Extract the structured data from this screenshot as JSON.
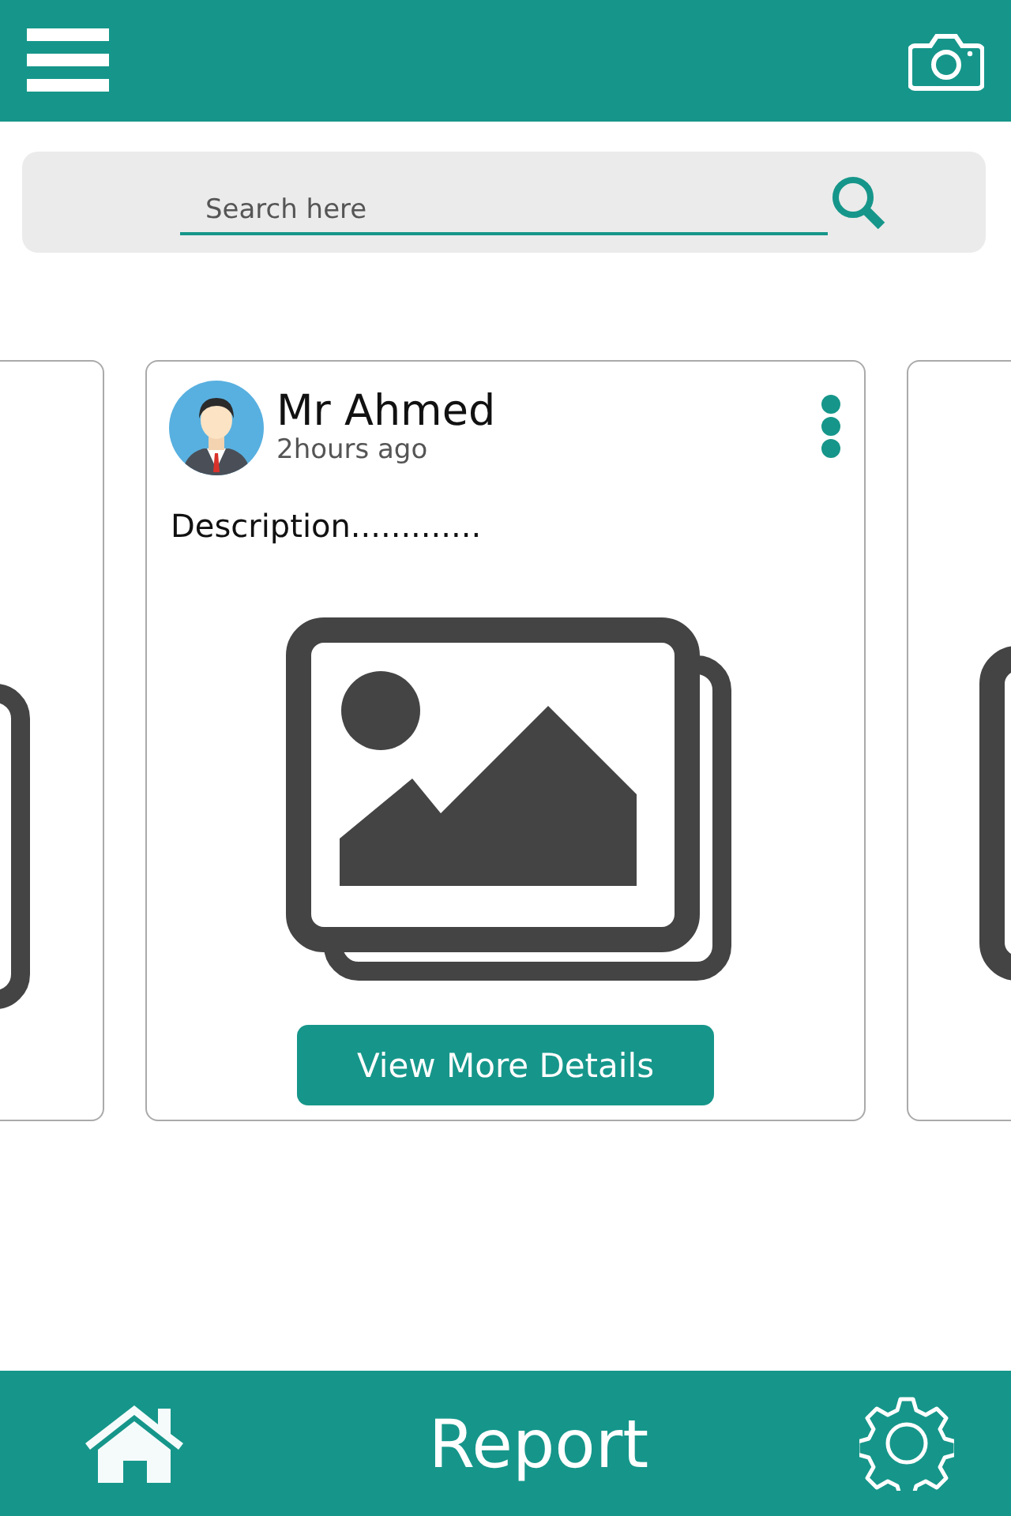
{
  "search": {
    "placeholder": "Search here"
  },
  "cards": [
    {
      "kind": "partial"
    },
    {
      "kind": "post",
      "author": "Mr Ahmed",
      "time": "2hours ago",
      "description": "Description.............",
      "button": "View More Details"
    },
    {
      "kind": "partial"
    }
  ],
  "footer": {
    "title": "Report"
  }
}
